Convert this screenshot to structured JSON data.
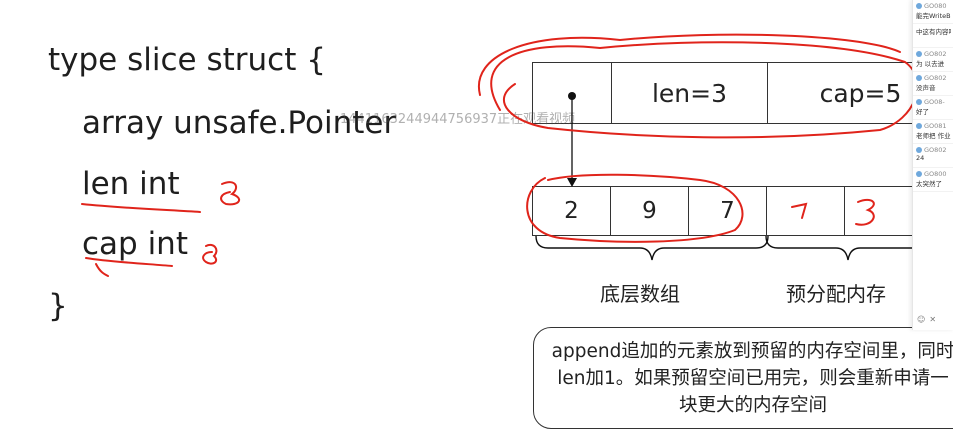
{
  "code": {
    "line1": "type slice struct {",
    "line2": "array unsafe.Pointer",
    "line3": "len int",
    "line4": "cap int",
    "line5": "}"
  },
  "header": {
    "len": "len=3",
    "cap": "cap=5"
  },
  "array": {
    "cells": [
      "2",
      "9",
      "7",
      "",
      ""
    ]
  },
  "labels": {
    "underlying": "底层数组",
    "prealloc": "预分配内存"
  },
  "note": "append追加的元素放到预留的内存空间里，同时len加1。如果预留空间已用完，则会重新申请一块更大的内存空间",
  "watermark": "1441163244944756937正在观看视频",
  "handwriting": {
    "len_mark": "8",
    "cap_mark": "8",
    "cell4": "7",
    "cell5": "8"
  },
  "chat": {
    "messages": [
      {
        "name": "GO080",
        "text": "能完WriteB"
      },
      {
        "name": "",
        "text": "中这有内容吗"
      },
      {
        "name": "GO802",
        "text": "为 以去进"
      },
      {
        "name": "GO802",
        "text": "没声音"
      },
      {
        "name": "GO08-",
        "text": "好了"
      },
      {
        "name": "GO081",
        "text": "老师把 作业"
      },
      {
        "name": "GO802",
        "text": "24"
      },
      {
        "name": "GO800",
        "text": "太突然了"
      }
    ]
  },
  "colors": {
    "ink": "#e0241b",
    "text": "#1e1e1e"
  }
}
